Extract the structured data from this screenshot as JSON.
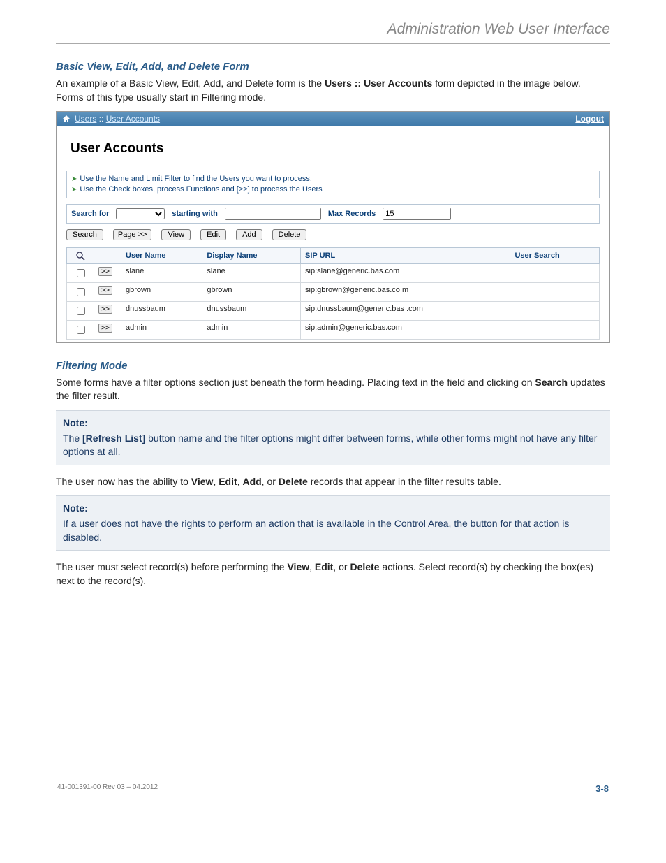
{
  "header": {
    "title": "Administration Web User Interface"
  },
  "section1": {
    "heading": "Basic View, Edit, Add, and Delete Form",
    "intro_pre": "An example of a Basic View, Edit, Add, and Delete form is the ",
    "intro_bold": "Users :: User Accounts",
    "intro_post": " form depicted in the image below. Forms of this type usually start in Filtering mode."
  },
  "app": {
    "breadcrumb": {
      "part1": "Users",
      "sep": " ::  ",
      "part2": "User Accounts"
    },
    "logout": "Logout",
    "title": "User Accounts",
    "tips": [
      "Use the Name and Limit Filter to find the Users you want to process.",
      "Use the Check boxes, process Functions and [>>] to process the Users"
    ],
    "filter": {
      "search_for": "Search for",
      "starting_with": "starting with",
      "max_records": "Max Records",
      "max_records_value": "15"
    },
    "buttons": {
      "search": "Search",
      "page": "Page >>",
      "view": "View",
      "edit": "Edit",
      "add": "Add",
      "delete": "Delete"
    },
    "columns": {
      "username": "User Name",
      "display": "Display Name",
      "sip": "SIP URL",
      "search": "User Search"
    },
    "rows": [
      {
        "go": ">>",
        "username": "slane",
        "display": "slane",
        "sip": "sip:slane@generic.bas.com",
        "search": ""
      },
      {
        "go": ">>",
        "username": "gbrown",
        "display": "gbrown",
        "sip": "sip:gbrown@generic.bas.co m",
        "search": ""
      },
      {
        "go": ">>",
        "username": "dnussbaum",
        "display": "dnussbaum",
        "sip": "sip:dnussbaum@generic.bas .com",
        "search": ""
      },
      {
        "go": ">>",
        "username": "admin",
        "display": "admin",
        "sip": "sip:admin@generic.bas.com",
        "search": ""
      }
    ]
  },
  "section2": {
    "heading": "Filtering Mode",
    "para_pre": "Some forms have a filter options section just beneath the form heading. Placing text in the field and clicking on ",
    "para_bold": "Search",
    "para_post": " updates the filter result."
  },
  "note1": {
    "label": "Note:",
    "pre": "The ",
    "bold": "[Refresh List]",
    "post": " button name and the filter options might differ between forms, while other forms might not have any filter options at all."
  },
  "para_actions": {
    "p1": "The user now has the ability to ",
    "b1": "View",
    "c1": ", ",
    "b2": "Edit",
    "c2": ", ",
    "b3": "Add",
    "c3": ", or ",
    "b4": "Delete",
    "p2": " records that appear in the filter results table."
  },
  "note2": {
    "label": "Note:",
    "text": "If a user does not have the rights to perform an action that is available in the Control Area, the button for that action is disabled."
  },
  "para_select": {
    "p1": "The user must select record(s) before performing the ",
    "b1": "View",
    "c1": ", ",
    "b2": "Edit",
    "c2": ", or ",
    "b3": "Delete",
    "p2": " actions. Select record(s) by checking the box(es) next to the record(s)."
  },
  "footer": {
    "left": "41-001391-00 Rev 03 – 04.2012",
    "right": "3-8"
  }
}
